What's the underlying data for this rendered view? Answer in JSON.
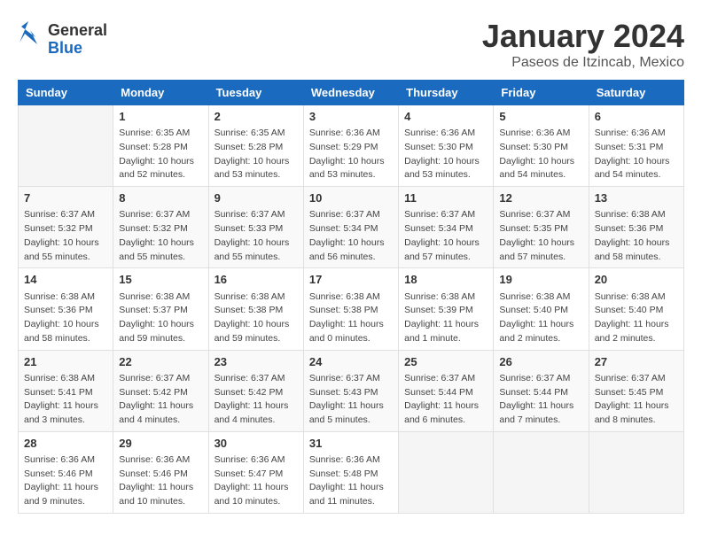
{
  "header": {
    "logo_line1": "General",
    "logo_line2": "Blue",
    "title": "January 2024",
    "subtitle": "Paseos de Itzincab, Mexico"
  },
  "days_of_week": [
    "Sunday",
    "Monday",
    "Tuesday",
    "Wednesday",
    "Thursday",
    "Friday",
    "Saturday"
  ],
  "weeks": [
    [
      {
        "day": "",
        "info": ""
      },
      {
        "day": "1",
        "info": "Sunrise: 6:35 AM\nSunset: 5:28 PM\nDaylight: 10 hours\nand 52 minutes."
      },
      {
        "day": "2",
        "info": "Sunrise: 6:35 AM\nSunset: 5:28 PM\nDaylight: 10 hours\nand 53 minutes."
      },
      {
        "day": "3",
        "info": "Sunrise: 6:36 AM\nSunset: 5:29 PM\nDaylight: 10 hours\nand 53 minutes."
      },
      {
        "day": "4",
        "info": "Sunrise: 6:36 AM\nSunset: 5:30 PM\nDaylight: 10 hours\nand 53 minutes."
      },
      {
        "day": "5",
        "info": "Sunrise: 6:36 AM\nSunset: 5:30 PM\nDaylight: 10 hours\nand 54 minutes."
      },
      {
        "day": "6",
        "info": "Sunrise: 6:36 AM\nSunset: 5:31 PM\nDaylight: 10 hours\nand 54 minutes."
      }
    ],
    [
      {
        "day": "7",
        "info": "Sunrise: 6:37 AM\nSunset: 5:32 PM\nDaylight: 10 hours\nand 55 minutes."
      },
      {
        "day": "8",
        "info": "Sunrise: 6:37 AM\nSunset: 5:32 PM\nDaylight: 10 hours\nand 55 minutes."
      },
      {
        "day": "9",
        "info": "Sunrise: 6:37 AM\nSunset: 5:33 PM\nDaylight: 10 hours\nand 55 minutes."
      },
      {
        "day": "10",
        "info": "Sunrise: 6:37 AM\nSunset: 5:34 PM\nDaylight: 10 hours\nand 56 minutes."
      },
      {
        "day": "11",
        "info": "Sunrise: 6:37 AM\nSunset: 5:34 PM\nDaylight: 10 hours\nand 57 minutes."
      },
      {
        "day": "12",
        "info": "Sunrise: 6:37 AM\nSunset: 5:35 PM\nDaylight: 10 hours\nand 57 minutes."
      },
      {
        "day": "13",
        "info": "Sunrise: 6:38 AM\nSunset: 5:36 PM\nDaylight: 10 hours\nand 58 minutes."
      }
    ],
    [
      {
        "day": "14",
        "info": "Sunrise: 6:38 AM\nSunset: 5:36 PM\nDaylight: 10 hours\nand 58 minutes."
      },
      {
        "day": "15",
        "info": "Sunrise: 6:38 AM\nSunset: 5:37 PM\nDaylight: 10 hours\nand 59 minutes."
      },
      {
        "day": "16",
        "info": "Sunrise: 6:38 AM\nSunset: 5:38 PM\nDaylight: 10 hours\nand 59 minutes."
      },
      {
        "day": "17",
        "info": "Sunrise: 6:38 AM\nSunset: 5:38 PM\nDaylight: 11 hours\nand 0 minutes."
      },
      {
        "day": "18",
        "info": "Sunrise: 6:38 AM\nSunset: 5:39 PM\nDaylight: 11 hours\nand 1 minute."
      },
      {
        "day": "19",
        "info": "Sunrise: 6:38 AM\nSunset: 5:40 PM\nDaylight: 11 hours\nand 2 minutes."
      },
      {
        "day": "20",
        "info": "Sunrise: 6:38 AM\nSunset: 5:40 PM\nDaylight: 11 hours\nand 2 minutes."
      }
    ],
    [
      {
        "day": "21",
        "info": "Sunrise: 6:38 AM\nSunset: 5:41 PM\nDaylight: 11 hours\nand 3 minutes."
      },
      {
        "day": "22",
        "info": "Sunrise: 6:37 AM\nSunset: 5:42 PM\nDaylight: 11 hours\nand 4 minutes."
      },
      {
        "day": "23",
        "info": "Sunrise: 6:37 AM\nSunset: 5:42 PM\nDaylight: 11 hours\nand 4 minutes."
      },
      {
        "day": "24",
        "info": "Sunrise: 6:37 AM\nSunset: 5:43 PM\nDaylight: 11 hours\nand 5 minutes."
      },
      {
        "day": "25",
        "info": "Sunrise: 6:37 AM\nSunset: 5:44 PM\nDaylight: 11 hours\nand 6 minutes."
      },
      {
        "day": "26",
        "info": "Sunrise: 6:37 AM\nSunset: 5:44 PM\nDaylight: 11 hours\nand 7 minutes."
      },
      {
        "day": "27",
        "info": "Sunrise: 6:37 AM\nSunset: 5:45 PM\nDaylight: 11 hours\nand 8 minutes."
      }
    ],
    [
      {
        "day": "28",
        "info": "Sunrise: 6:36 AM\nSunset: 5:46 PM\nDaylight: 11 hours\nand 9 minutes."
      },
      {
        "day": "29",
        "info": "Sunrise: 6:36 AM\nSunset: 5:46 PM\nDaylight: 11 hours\nand 10 minutes."
      },
      {
        "day": "30",
        "info": "Sunrise: 6:36 AM\nSunset: 5:47 PM\nDaylight: 11 hours\nand 10 minutes."
      },
      {
        "day": "31",
        "info": "Sunrise: 6:36 AM\nSunset: 5:48 PM\nDaylight: 11 hours\nand 11 minutes."
      },
      {
        "day": "",
        "info": ""
      },
      {
        "day": "",
        "info": ""
      },
      {
        "day": "",
        "info": ""
      }
    ]
  ]
}
